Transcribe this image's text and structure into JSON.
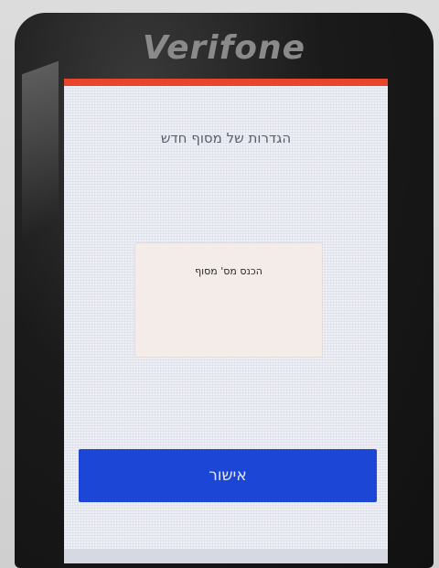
{
  "device": {
    "brand": "Verifone"
  },
  "screen": {
    "title": "הגדרות של מסוף חדש",
    "dialog_text": "הכנס מס' מסוף",
    "confirm_label": "אישור"
  },
  "colors": {
    "accent_bar": "#e8452c",
    "button": "#1c47d6"
  }
}
